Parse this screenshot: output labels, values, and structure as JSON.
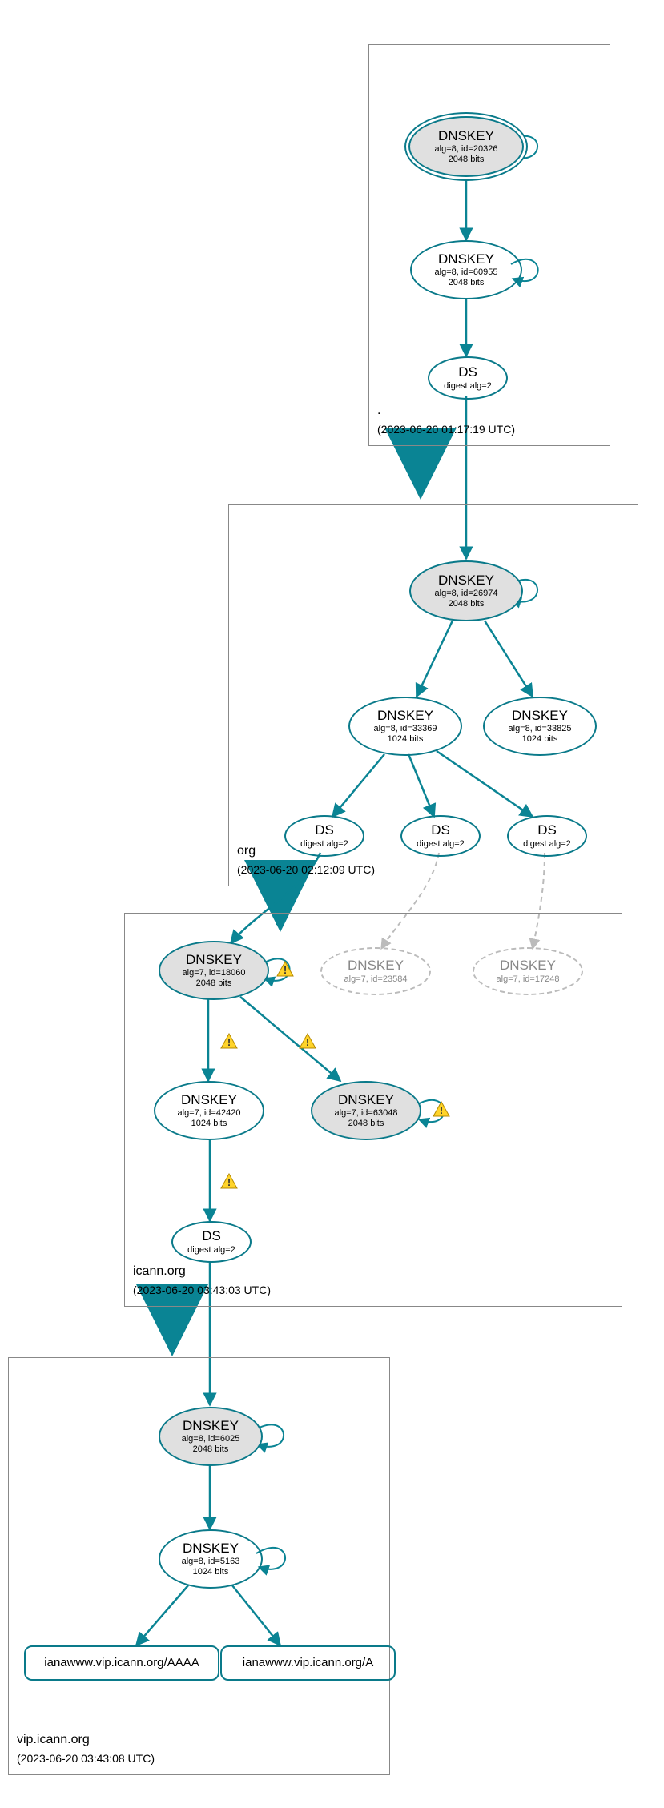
{
  "zones": {
    "root": {
      "name": ".",
      "ts": "(2023-06-20 01:17:19 UTC)"
    },
    "org": {
      "name": "org",
      "ts": "(2023-06-20 02:12:09 UTC)"
    },
    "icann": {
      "name": "icann.org",
      "ts": "(2023-06-20 03:43:03 UTC)"
    },
    "vip": {
      "name": "vip.icann.org",
      "ts": "(2023-06-20 03:43:08 UTC)"
    }
  },
  "labels": {
    "DNSKEY": "DNSKEY",
    "DS": "DS"
  },
  "nodes": {
    "root_ksk": {
      "l1": "DNSKEY",
      "l2": "alg=8, id=20326",
      "l3": "2048 bits"
    },
    "root_zsk": {
      "l1": "DNSKEY",
      "l2": "alg=8, id=60955",
      "l3": "2048 bits"
    },
    "root_ds": {
      "l1": "DS",
      "l2": "digest alg=2"
    },
    "org_ksk": {
      "l1": "DNSKEY",
      "l2": "alg=8, id=26974",
      "l3": "2048 bits"
    },
    "org_zsk1": {
      "l1": "DNSKEY",
      "l2": "alg=8, id=33369",
      "l3": "1024 bits"
    },
    "org_zsk2": {
      "l1": "DNSKEY",
      "l2": "alg=8, id=33825",
      "l3": "1024 bits"
    },
    "org_ds1": {
      "l1": "DS",
      "l2": "digest alg=2"
    },
    "org_ds2": {
      "l1": "DS",
      "l2": "digest alg=2"
    },
    "org_ds3": {
      "l1": "DS",
      "l2": "digest alg=2"
    },
    "icann_ksk": {
      "l1": "DNSKEY",
      "l2": "alg=7, id=18060",
      "l3": "2048 bits"
    },
    "icann_d1": {
      "l1": "DNSKEY",
      "l2": "alg=7, id=23584"
    },
    "icann_d2": {
      "l1": "DNSKEY",
      "l2": "alg=7, id=17248"
    },
    "icann_zsk": {
      "l1": "DNSKEY",
      "l2": "alg=7, id=42420",
      "l3": "1024 bits"
    },
    "icann_sep": {
      "l1": "DNSKEY",
      "l2": "alg=7, id=63048",
      "l3": "2048 bits"
    },
    "icann_ds": {
      "l1": "DS",
      "l2": "digest alg=2"
    },
    "vip_ksk": {
      "l1": "DNSKEY",
      "l2": "alg=8, id=6025",
      "l3": "2048 bits"
    },
    "vip_zsk": {
      "l1": "DNSKEY",
      "l2": "alg=8, id=5163",
      "l3": "1024 bits"
    },
    "vip_aaaa": {
      "l1": "ianawww.vip.icann.org/AAAA"
    },
    "vip_a": {
      "l1": "ianawww.vip.icann.org/A"
    }
  }
}
